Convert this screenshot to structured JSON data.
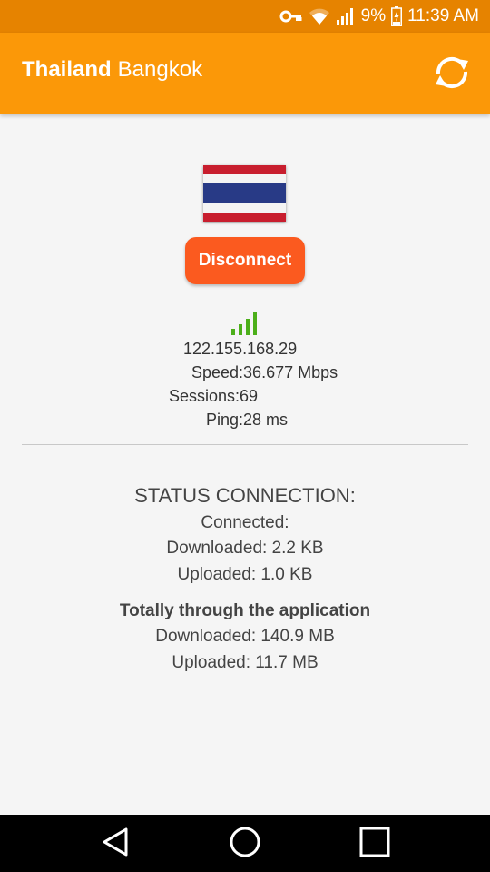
{
  "status_bar": {
    "battery": "9%",
    "time": "11:39 AM",
    "icons": [
      "vpn-key-icon",
      "wifi-icon",
      "cell-signal-icon",
      "battery-icon"
    ]
  },
  "app_bar": {
    "country": "Thailand",
    "city": "Bangkok",
    "refresh_icon": "refresh-icon",
    "colors": {
      "status_bar": "#e68300",
      "app_bar": "#fb9808"
    }
  },
  "server": {
    "flag": "thailand-flag",
    "button_label": "Disconnect",
    "button_color": "#fb5a1f",
    "signal_icon": "signal-strength-icon",
    "signal_color": "#4caf1a",
    "ip": "122.155.168.29",
    "speed": "Speed:36.677 Mbps",
    "sessions": "Sessions:69",
    "ping": "Ping:28 ms"
  },
  "status": {
    "heading": "STATUS CONNECTION:",
    "state": "Connected:",
    "downloaded": "Downloaded: 2.2 KB",
    "uploaded": "Uploaded: 1.0 KB"
  },
  "totals": {
    "heading": "Totally through the application",
    "downloaded": "Downloaded: 140.9 MB",
    "uploaded": "Uploaded: 11.7 MB"
  },
  "nav_bar": {
    "buttons": [
      "back-icon",
      "home-icon",
      "recents-icon"
    ]
  }
}
